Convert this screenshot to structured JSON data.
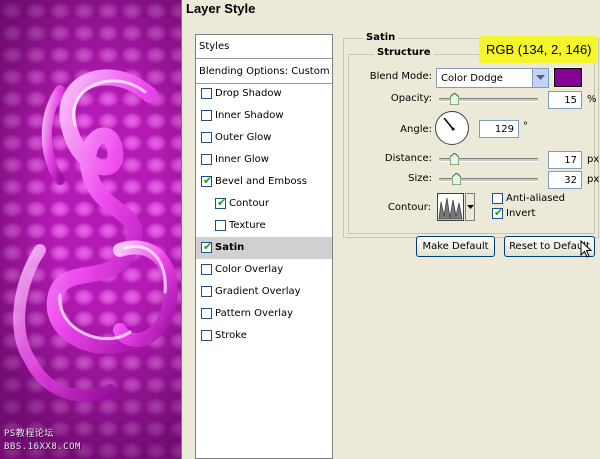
{
  "window": {
    "title": "Layer Style"
  },
  "artwork": {
    "watermark_line1": "PS教程论坛",
    "watermark_line2": "BBS.16XX8.COM",
    "base_color": "#b41ab4"
  },
  "styles_panel": {
    "header": "Styles",
    "blending_options": "Blending Options: Custom",
    "items": [
      {
        "label": "Drop Shadow",
        "checked": false,
        "indent": false,
        "selected": false
      },
      {
        "label": "Inner Shadow",
        "checked": false,
        "indent": false,
        "selected": false
      },
      {
        "label": "Outer Glow",
        "checked": false,
        "indent": false,
        "selected": false
      },
      {
        "label": "Inner Glow",
        "checked": false,
        "indent": false,
        "selected": false
      },
      {
        "label": "Bevel and Emboss",
        "checked": true,
        "indent": false,
        "selected": false
      },
      {
        "label": "Contour",
        "checked": true,
        "indent": true,
        "selected": false
      },
      {
        "label": "Texture",
        "checked": false,
        "indent": true,
        "selected": false
      },
      {
        "label": "Satin",
        "checked": true,
        "indent": false,
        "selected": true
      },
      {
        "label": "Color Overlay",
        "checked": false,
        "indent": false,
        "selected": false
      },
      {
        "label": "Gradient Overlay",
        "checked": false,
        "indent": false,
        "selected": false
      },
      {
        "label": "Pattern Overlay",
        "checked": false,
        "indent": false,
        "selected": false
      },
      {
        "label": "Stroke",
        "checked": false,
        "indent": false,
        "selected": false
      }
    ]
  },
  "satin": {
    "group_title": "Satin",
    "structure_title": "Structure",
    "blend_mode_label": "Blend Mode:",
    "blend_mode_value": "Color Dodge",
    "blend_color": "#860292",
    "opacity_label": "Opacity:",
    "opacity_value": "15",
    "opacity_unit": "%",
    "angle_label": "Angle:",
    "angle_value": "129",
    "angle_unit": "°",
    "distance_label": "Distance:",
    "distance_value": "17",
    "distance_unit": "px",
    "size_label": "Size:",
    "size_value": "32",
    "size_unit": "px",
    "contour_label": "Contour:",
    "anti_aliased_label": "Anti-aliased",
    "anti_aliased_checked": false,
    "invert_label": "Invert",
    "invert_checked": true,
    "make_default_label": "Make Default",
    "reset_default_label": "Reset to Default"
  },
  "callout": {
    "text": "RGB (134, 2, 146)",
    "color": "#f5f52c"
  }
}
